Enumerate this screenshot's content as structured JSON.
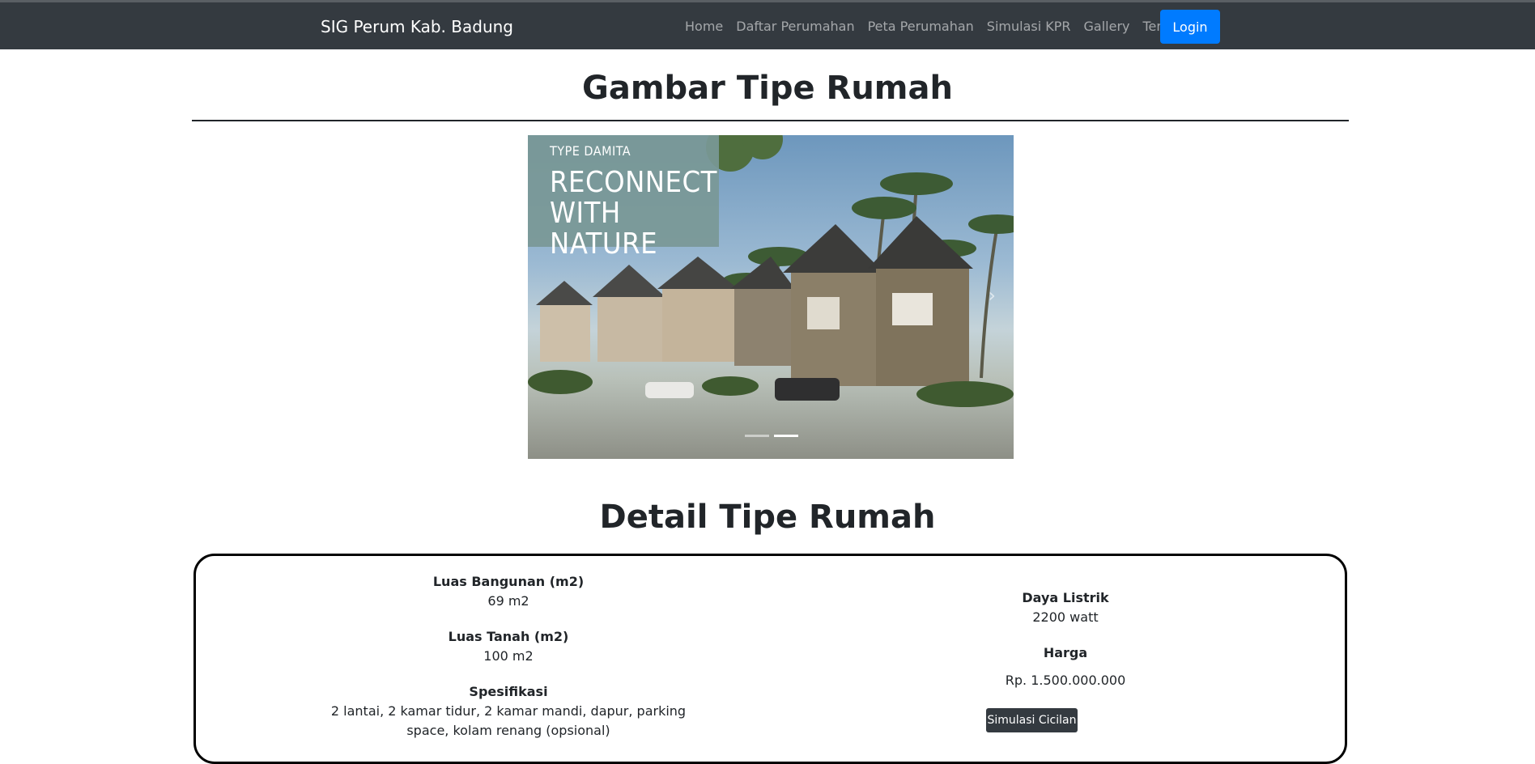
{
  "navbar": {
    "brand": "SIG Perum Kab. Badung",
    "links": [
      "Home",
      "Daftar Perumahan",
      "Peta Perumahan",
      "Simulasi KPR",
      "Gallery",
      "Tentang"
    ],
    "login_label": "Login"
  },
  "gallery": {
    "heading": "Gambar Tipe Rumah",
    "slide_caption_type": "TYPE DAMITA",
    "slide_caption_line1": "RECONNECT",
    "slide_caption_line2": "WITH NATURE",
    "indicator_count": 2,
    "active_indicator": 2
  },
  "detail": {
    "heading": "Detail Tipe Rumah",
    "luas_bangunan_label": "Luas Bangunan (m2)",
    "luas_bangunan_value": "69 m2",
    "luas_tanah_label": "Luas Tanah (m2)",
    "luas_tanah_value": "100 m2",
    "spesifikasi_label": "Spesifikasi",
    "spesifikasi_value": "2 lantai, 2 kamar tidur, 2 kamar mandi, dapur, parking space, kolam renang (opsional)",
    "daya_listrik_label": "Daya Listrik",
    "daya_listrik_value": "2200 watt",
    "harga_label": "Harga",
    "harga_value": "Rp. 1.500.000.000",
    "simulasi_button": "Simulasi Cicilan"
  },
  "colors": {
    "navbar_bg": "#343a40",
    "login_bg": "#007bff",
    "button_dark": "#343a40"
  }
}
